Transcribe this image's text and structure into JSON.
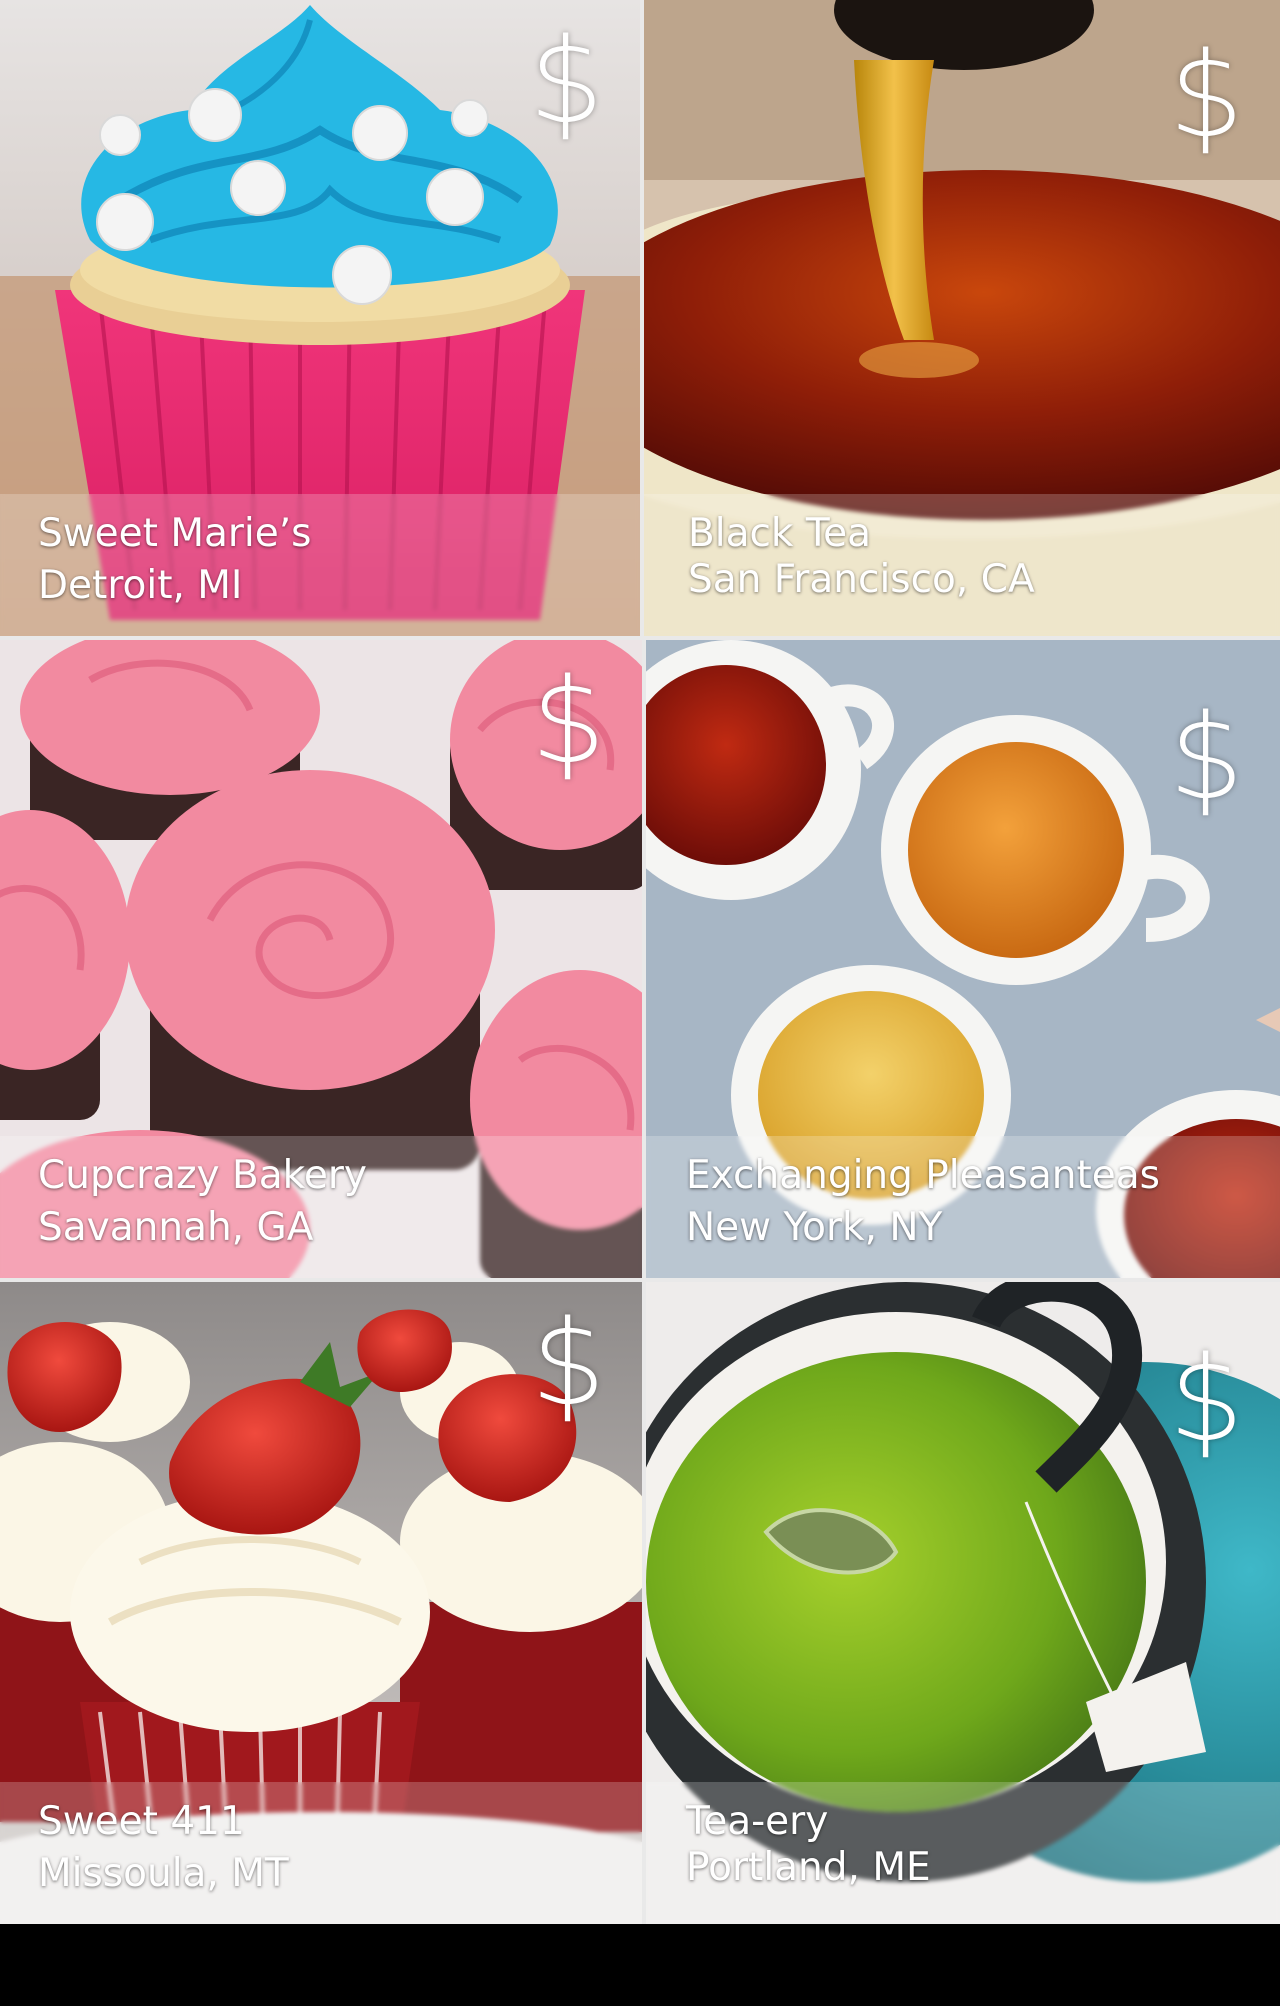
{
  "listings": [
    {
      "name": "Sweet Marie’s",
      "location": "Detroit, MI",
      "price": "$",
      "category": "cupcake"
    },
    {
      "name": "Black Tea",
      "location": "San Francisco, CA",
      "price": "$",
      "category": "tea"
    },
    {
      "name": "Cupcrazy Bakery",
      "location": "Savannah, GA",
      "price": "$",
      "category": "cupcake"
    },
    {
      "name": "Exchanging Pleasanteas",
      "location": "New York, NY",
      "price": "$",
      "category": "tea"
    },
    {
      "name": "Sweet 411",
      "location": "Missoula, MT",
      "price": "$",
      "category": "cupcake"
    },
    {
      "name": "Tea-ery",
      "location": "Portland, ME",
      "price": "$",
      "category": "tea"
    }
  ]
}
